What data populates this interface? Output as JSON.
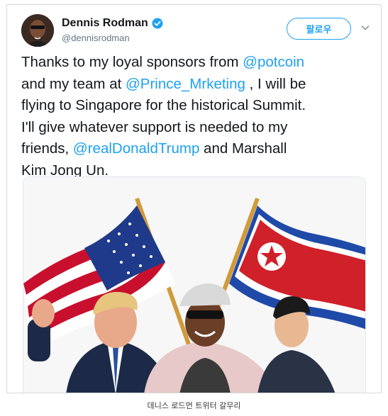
{
  "tweet": {
    "author_name": "Dennis Rodman",
    "author_handle": "@dennisrodman",
    "follow_label": "팔로우",
    "text_parts": [
      {
        "t": "Thanks to my loyal sponsors from ",
        "m": false
      },
      {
        "t": "@potcoin",
        "m": true
      },
      {
        "t": "\nand my team at ",
        "m": false
      },
      {
        "t": "@Prince_Mrketing",
        "m": true
      },
      {
        "t": " , I will be\nflying to Singapore for the historical Summit.\nI'll give whatever support is needed to my\nfriends, ",
        "m": false
      },
      {
        "t": "@realDonaldTrump",
        "m": true
      },
      {
        "t": " and Marshall\nKim Jong Un.",
        "m": false
      }
    ]
  },
  "caption": "데니스 로드먼 트위터 갈무리",
  "colors": {
    "link": "#1da1f2",
    "text": "#14171a",
    "handle": "#657786"
  }
}
